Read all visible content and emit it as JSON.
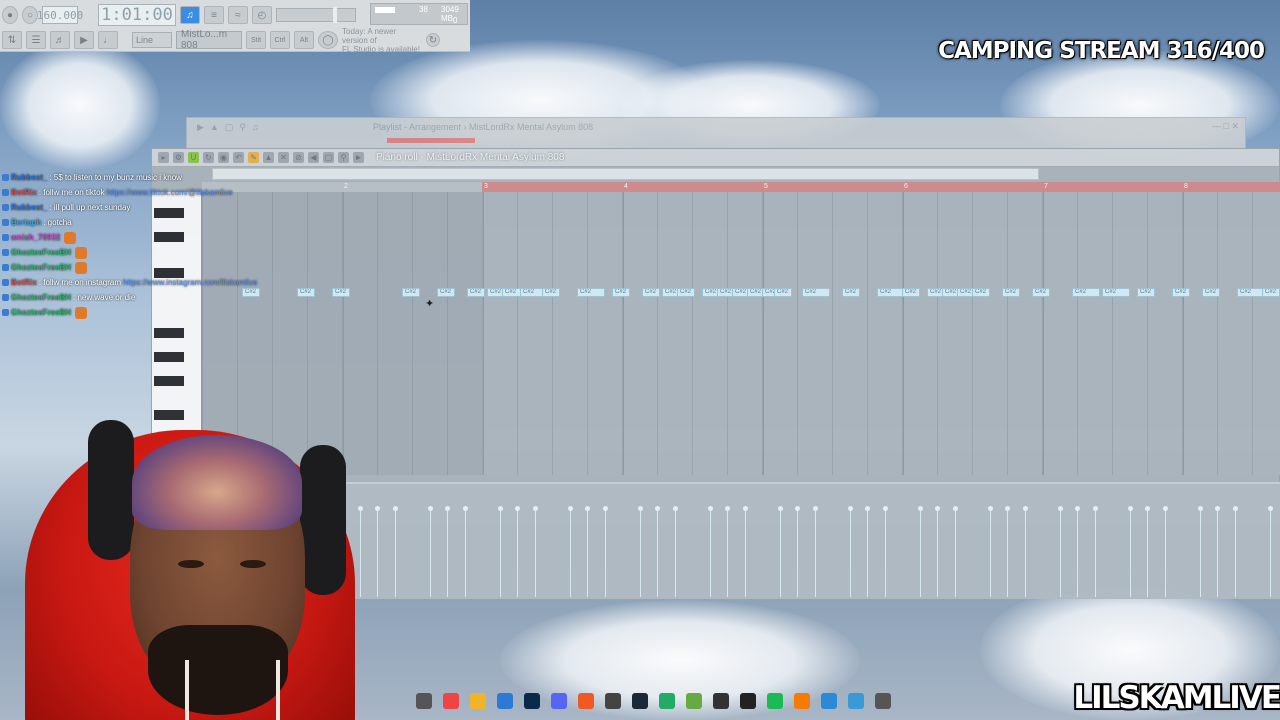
{
  "toolbar": {
    "tempo": "160.000",
    "time": "1:01:00",
    "snap": "Line",
    "pattern": "MistLo...m 808",
    "news_line1": "Today: A newer version of",
    "news_line2": "FL Studio is available!",
    "cpu_value": "38",
    "mem_value": "3049 MB",
    "poly_value": "0"
  },
  "overlay": {
    "stream_title": "CAMPING STREAM 316/400",
    "channel": "LILSKAMLIVE"
  },
  "playlist": {
    "title": "Playlist - Arrangement › MistLordRx Mental Asylum 808"
  },
  "piano_roll": {
    "title": "Piano roll - MistLordRx Mental Asylum 808",
    "bar_numbers": [
      "2",
      "3",
      "4",
      "5",
      "6",
      "7",
      "8"
    ],
    "note_label": "C#2"
  },
  "chat": [
    {
      "user": "Rubbest_",
      "text": ": 5$ to listen to my bunz music i know",
      "color": "#2f6fd6"
    },
    {
      "user": "BotRix",
      "text": ": follw me on tiktok",
      "link": "https://www.tiktok.com/@lilskamlive",
      "color": "#d84a4a"
    },
    {
      "user": "Rubbest_",
      "text": ": ill pull up next sunday",
      "color": "#2f6fd6"
    },
    {
      "user": "Bertaph",
      "text": ": gotcha",
      "color": "#3aa0d6"
    },
    {
      "user": "wnish_70932",
      "text": "",
      "color": "#c04ac0"
    },
    {
      "user": "GhozteeFreeBH",
      "text": "",
      "color": "#2fae6a"
    },
    {
      "user": "GhozteeFreeBH",
      "text": "",
      "color": "#2fae6a"
    },
    {
      "user": "BotRix",
      "text": ": follw me on instagram",
      "link": "https://www.instagram.com/lilskamlive",
      "color": "#d84a4a"
    },
    {
      "user": "GhozteeFreeBH",
      "text": ": new wave or die",
      "color": "#2fae6a"
    },
    {
      "user": "GhozteeFreeBH",
      "text": "",
      "color": "#2fae6a"
    }
  ],
  "taskbar": [
    "search-icon",
    "chrome-icon",
    "folder-icon",
    "store-icon",
    "photoshop-icon",
    "discord-icon",
    "brave-icon",
    "obs-icon",
    "steam-icon",
    "app-icon",
    "layers-icon",
    "4k-icon",
    "capcut-icon",
    "spotify-icon",
    "fl-studio-icon",
    "app2-icon",
    "notepad-icon",
    "media-icon"
  ]
}
